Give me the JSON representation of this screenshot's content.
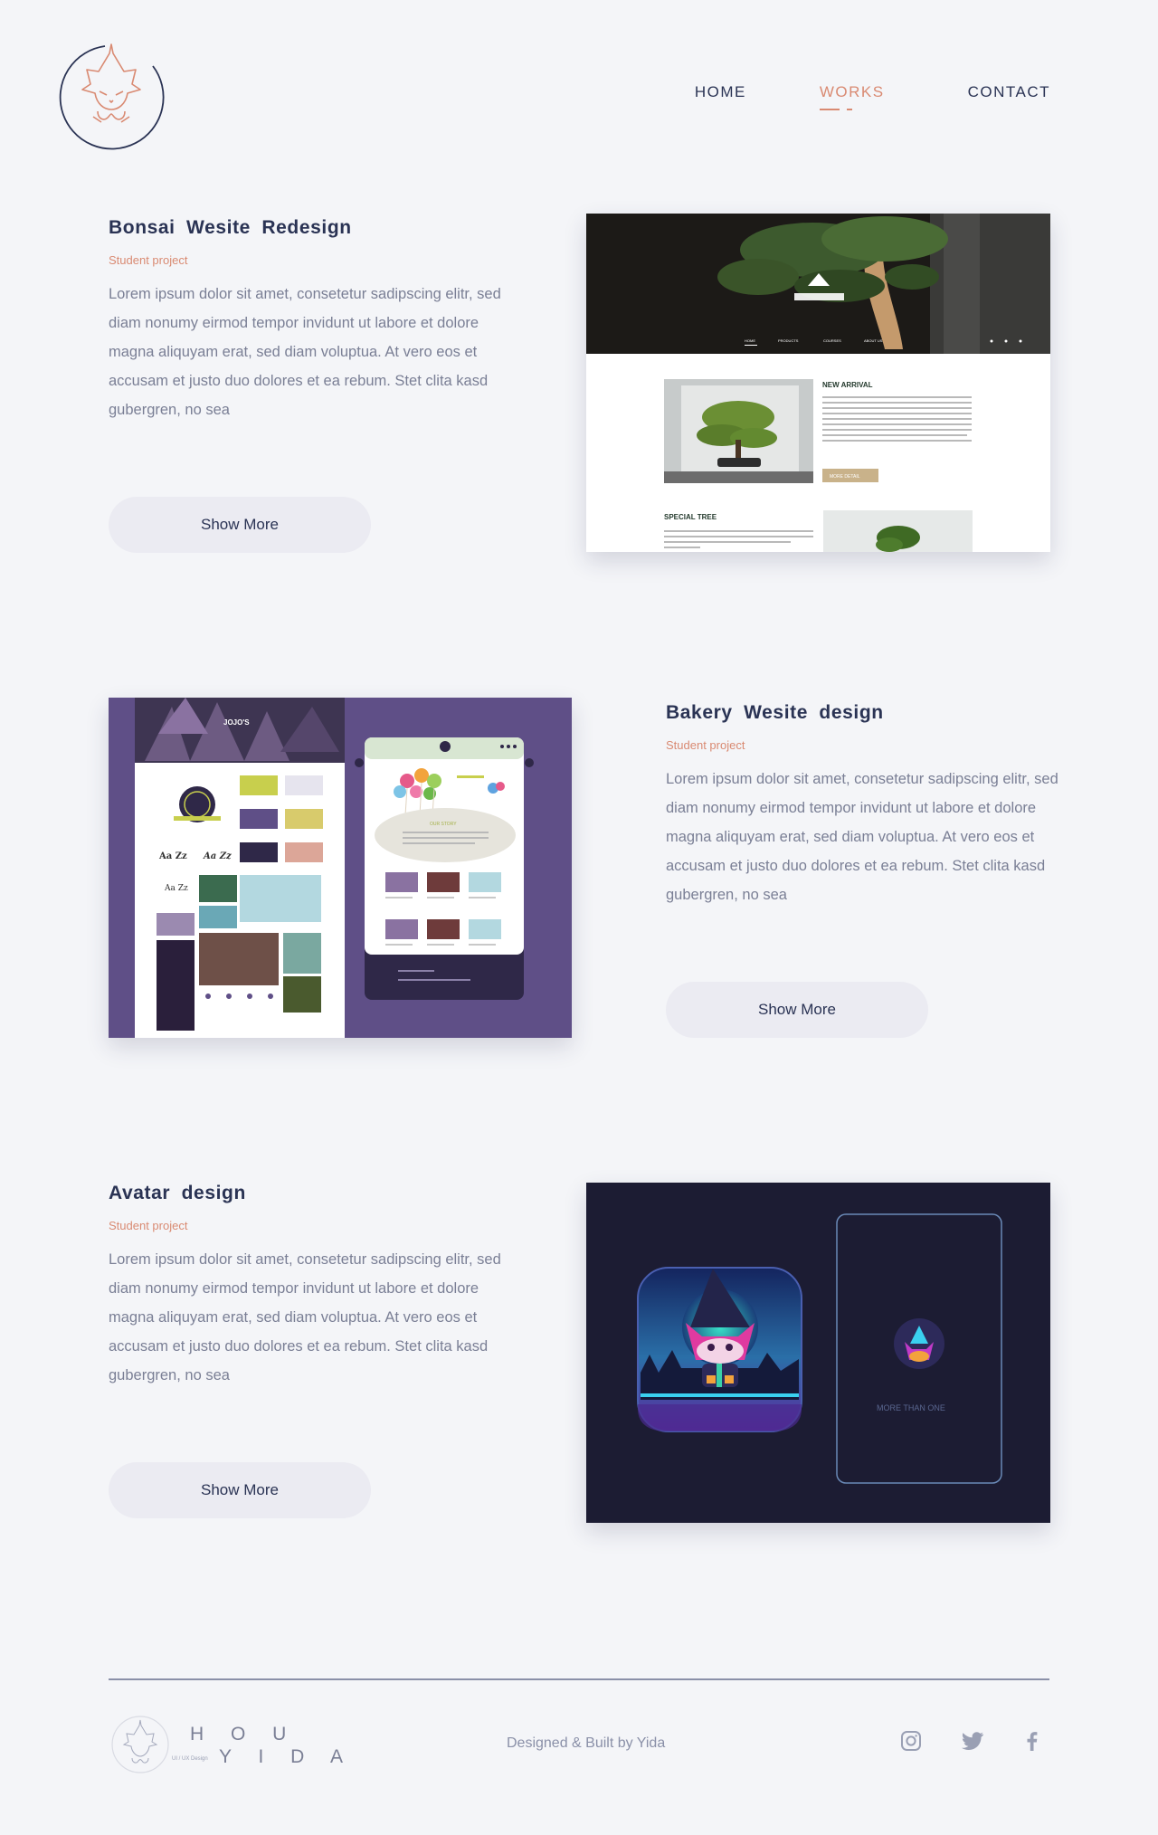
{
  "nav": {
    "home": "HOME",
    "works": "WORKS",
    "contact": "CONTACT",
    "active": "WORKS"
  },
  "projects": [
    {
      "title": "Bonsai  Wesite  Redesign",
      "subtitle": "Student project",
      "description": "Lorem ipsum dolor sit amet, consetetur sadipscing elitr, sed diam nonumy eirmod tempor invidunt ut labore et dolore magna aliquyam erat, sed diam voluptua. At vero eos et accusam et justo duo dolores et ea rebum. Stet clita kasd gubergren, no sea",
      "button": "Show More",
      "preview": {
        "nav": [
          "HOME",
          "PRODUCTS",
          "COURSES",
          "ABOUT US"
        ],
        "section1": "NEW ARRIVAL",
        "cta": "MORE DETAIL",
        "section2": "SPECIAL TREE"
      }
    },
    {
      "title": "Bakery  Wesite  design",
      "subtitle": "Student project",
      "description": "Lorem ipsum dolor sit amet, consetetur sadipscing elitr, sed diam nonumy eirmod tempor invidunt ut labore et dolore magna aliquyam erat, sed diam voluptua. At vero eos et accusam et justo duo dolores et ea rebum. Stet clita kasd gubergren, no sea",
      "button": "Show More",
      "preview": {
        "brand": "JOJO'S",
        "type1": "Aa Zz",
        "type2": "Aa Zz",
        "type3": "Aa Zz",
        "story": "OUR STORY"
      }
    },
    {
      "title": "Avatar  design",
      "subtitle": "Student project",
      "description": "Lorem ipsum dolor sit amet, consetetur sadipscing elitr, sed diam nonumy eirmod tempor invidunt ut labore et dolore magna aliquyam erat, sed diam voluptua. At vero eos et accusam et justo duo dolores et ea rebum. Stet clita kasd gubergren, no sea",
      "button": "Show More",
      "preview": {
        "caption": "MORE THAN ONE"
      }
    }
  ],
  "footer": {
    "brand_top": "H O U",
    "brand_bottom": "Y I D A",
    "brand_tag": "UI / UX Design",
    "credit": "Designed & Built by Yida",
    "social": [
      "instagram-icon",
      "twitter-icon",
      "facebook-icon"
    ]
  },
  "colors": {
    "accent": "#d98a72",
    "navy": "#2a3354",
    "text": "#7a7f95",
    "bg": "#f4f5f8"
  }
}
